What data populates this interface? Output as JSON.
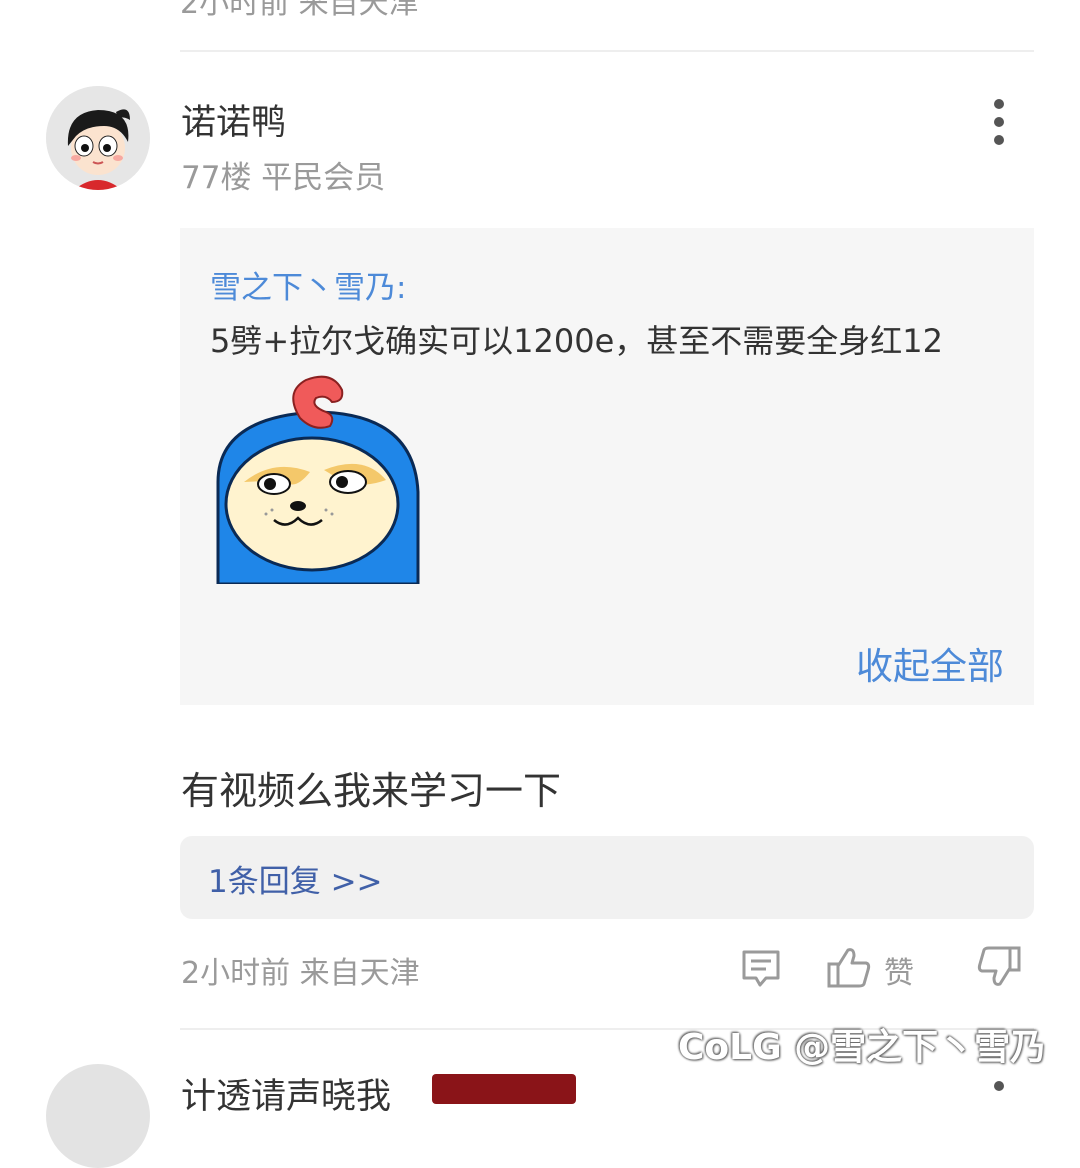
{
  "previous_comment": {
    "cut_text": "2小时前 来自天津"
  },
  "comment": {
    "username": "诺诺鸭",
    "meta": "77楼 平民会员",
    "quote": {
      "author": "雪之下丶雪乃:",
      "text": "5劈+拉尔戈确实可以1200e，甚至不需要全身红12",
      "collapse_label": "收起全部"
    },
    "body": "有视频么我来学习一下",
    "replies_label": "1条回复 >>",
    "footer_meta": "2小时前 来自天津",
    "like_label": "赞"
  },
  "next_comment": {
    "username": "计透请声晓我",
    "badge_color": "#8a1418"
  },
  "watermark": "CoLG @雪之下丶雪乃",
  "colors": {
    "link_blue": "#4d8ad8",
    "reply_blue": "#4060a8",
    "meta_gray": "#9a9a9a"
  }
}
